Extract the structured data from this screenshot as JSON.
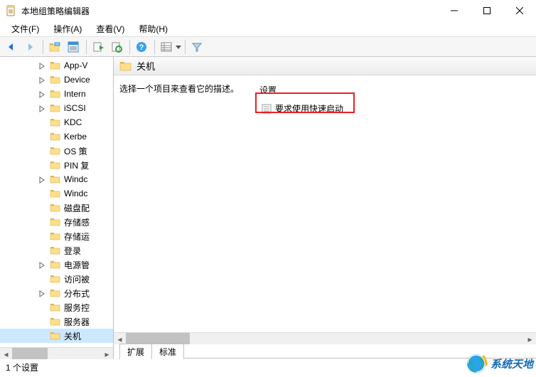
{
  "window": {
    "title": "本地组策略编辑器"
  },
  "menu": {
    "file": "文件(F)",
    "action": "操作(A)",
    "view": "查看(V)",
    "help": "帮助(H)"
  },
  "toolbar": {
    "back": "back",
    "forward": "forward",
    "up": "up-one-level",
    "show_hide": "show-hide-console-tree",
    "props": "properties",
    "refresh": "refresh",
    "export": "export-list",
    "help": "help",
    "details": "details-view",
    "filter": "filter"
  },
  "tree": {
    "items": [
      {
        "label": "App-V",
        "expandable": true
      },
      {
        "label": "Device",
        "expandable": true
      },
      {
        "label": "Intern",
        "expandable": true
      },
      {
        "label": "iSCSI",
        "expandable": true
      },
      {
        "label": "KDC",
        "expandable": false
      },
      {
        "label": "Kerbe",
        "expandable": false
      },
      {
        "label": "OS 策",
        "expandable": false
      },
      {
        "label": "PIN 复",
        "expandable": false
      },
      {
        "label": "Windc",
        "expandable": true
      },
      {
        "label": "Windc",
        "expandable": false
      },
      {
        "label": "磁盘配",
        "expandable": false
      },
      {
        "label": "存储感",
        "expandable": false
      },
      {
        "label": "存储运",
        "expandable": false
      },
      {
        "label": "登录",
        "expandable": false
      },
      {
        "label": "电源管",
        "expandable": true
      },
      {
        "label": "访问被",
        "expandable": false
      },
      {
        "label": "分布式",
        "expandable": true
      },
      {
        "label": "服务控",
        "expandable": false
      },
      {
        "label": "服务器",
        "expandable": false
      },
      {
        "label": "关机",
        "expandable": false,
        "selected": true
      }
    ]
  },
  "panel": {
    "heading": "关机",
    "hint": "选择一个项目来查看它的描述。",
    "settings_header": "设置",
    "settings": [
      {
        "label": "要求使用快速启动"
      }
    ]
  },
  "tabs": {
    "extended": "扩展",
    "standard": "标准"
  },
  "status": {
    "text": "1 个设置"
  },
  "watermark": {
    "text": "系统天地"
  }
}
